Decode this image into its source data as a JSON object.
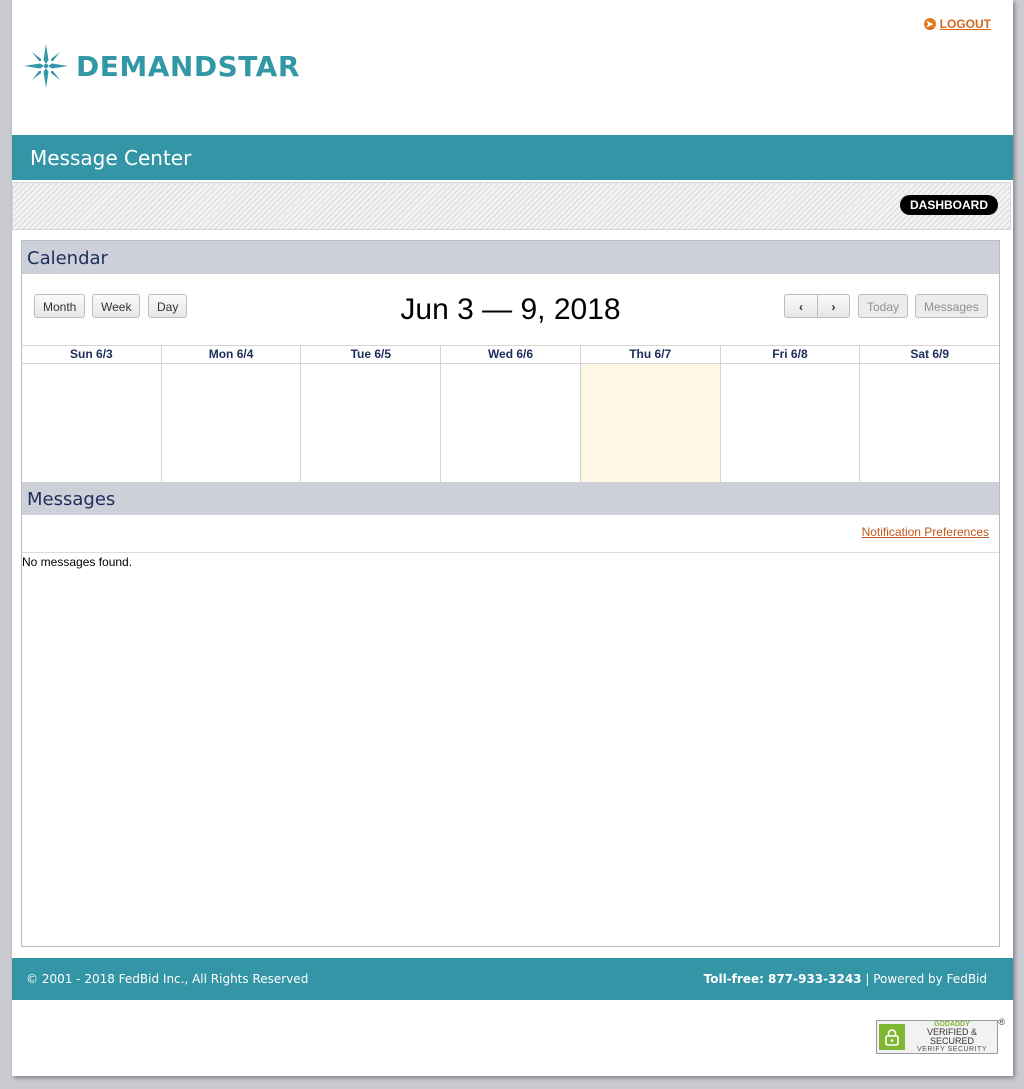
{
  "header": {
    "logout_label": "LOGOUT",
    "brand_name": "DEMANDSTAR"
  },
  "title_bar": {
    "title": "Message Center"
  },
  "subnav": {
    "dashboard_label": "DASHBOARD"
  },
  "calendar": {
    "section_title": "Calendar",
    "view_buttons": [
      "Month",
      "Week",
      "Day"
    ],
    "range_title": "Jun 3 — 9, 2018",
    "today_label": "Today",
    "messages_label": "Messages",
    "days": [
      "Sun 6/3",
      "Mon 6/4",
      "Tue 6/5",
      "Wed 6/6",
      "Thu 6/7",
      "Fri 6/8",
      "Sat 6/9"
    ],
    "highlighted_day": "Thu 6/7"
  },
  "messages": {
    "section_title": "Messages",
    "preferences_link": "Notification Preferences",
    "empty_text": "No messages found."
  },
  "footer": {
    "copyright": "© 2001 - 2018 FedBid Inc., All Rights Reserved",
    "tollfree_label": "Toll-free: 877-933-3243",
    "separator": " | ",
    "powered_by": "Powered by FedBid"
  },
  "security_badge": {
    "line1": "GODADDY",
    "line2": "VERIFIED & SECURED",
    "line3": "VERIFY SECURITY",
    "mark": "®"
  },
  "colors": {
    "brand_teal": "#3395a5",
    "link_orange": "#c0571d",
    "today_highlight": "#fcf8e3",
    "section_header": "#cdd0d8"
  }
}
